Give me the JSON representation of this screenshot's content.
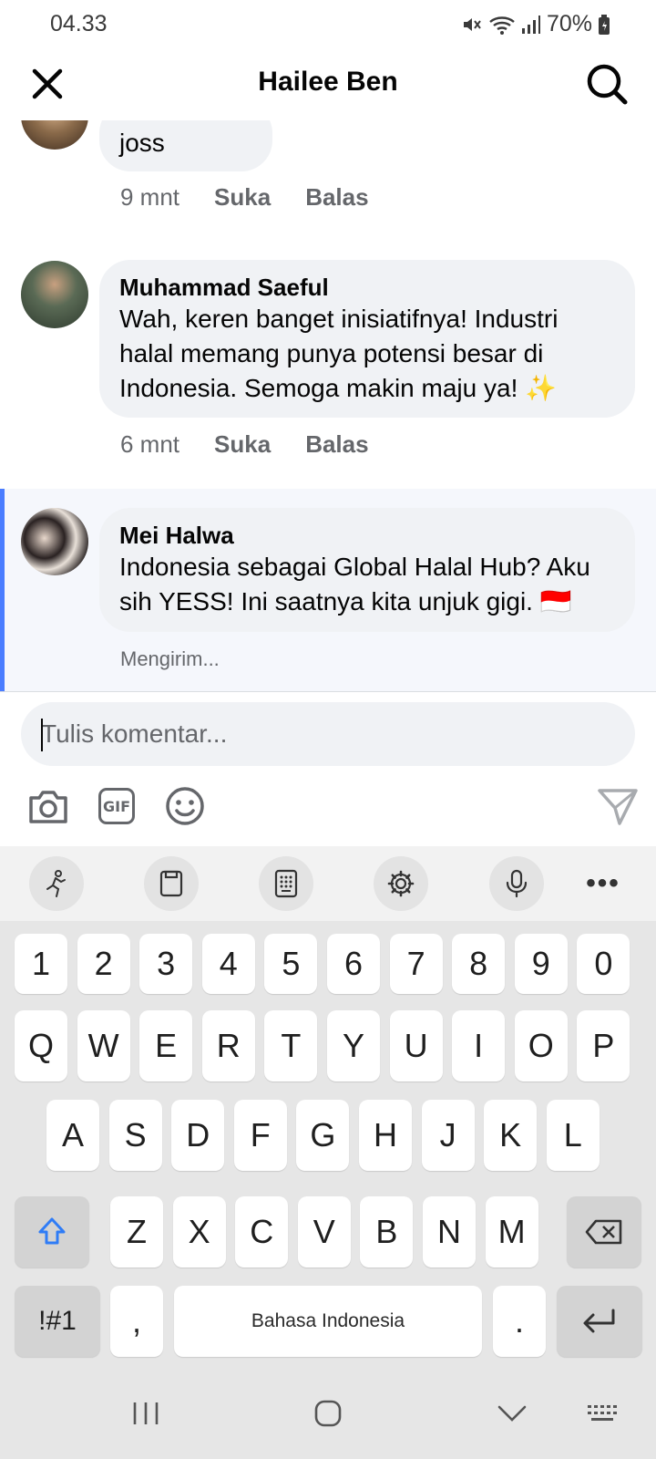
{
  "status_bar": {
    "time": "04.33",
    "battery": "70%"
  },
  "header": {
    "title": "Hailee Ben"
  },
  "comments": [
    {
      "author": "",
      "text": "joss",
      "time": "9 mnt",
      "like": "Suka",
      "reply": "Balas"
    },
    {
      "author": "Muhammad Saeful",
      "text": "Wah, keren banget inisiatifnya! Industri halal memang punya potensi besar di Indonesia. Semoga makin maju ya! ✨",
      "time": "6 mnt",
      "like": "Suka",
      "reply": "Balas"
    },
    {
      "author": "Mei Halwa",
      "text": "Indonesia sebagai Global Halal Hub? Aku sih YESS! Ini saatnya kita unjuk gigi. 🇮🇩",
      "status": "Mengirim..."
    }
  ],
  "composer": {
    "placeholder": "Tulis komentar...",
    "gif_label": "GIF"
  },
  "keyboard": {
    "numbers": [
      "1",
      "2",
      "3",
      "4",
      "5",
      "6",
      "7",
      "8",
      "9",
      "0"
    ],
    "row1": [
      "Q",
      "W",
      "E",
      "R",
      "T",
      "Y",
      "U",
      "I",
      "O",
      "P"
    ],
    "row2": [
      "A",
      "S",
      "D",
      "F",
      "G",
      "H",
      "J",
      "K",
      "L"
    ],
    "row3": [
      "Z",
      "X",
      "C",
      "V",
      "B",
      "N",
      "M"
    ],
    "symbols": "!#1",
    "comma": ",",
    "space": "Bahasa Indonesia",
    "period": "."
  },
  "colors": {
    "accent": "#4a7dff",
    "bubble": "#f0f2f5",
    "secondary_text": "#65676b"
  }
}
